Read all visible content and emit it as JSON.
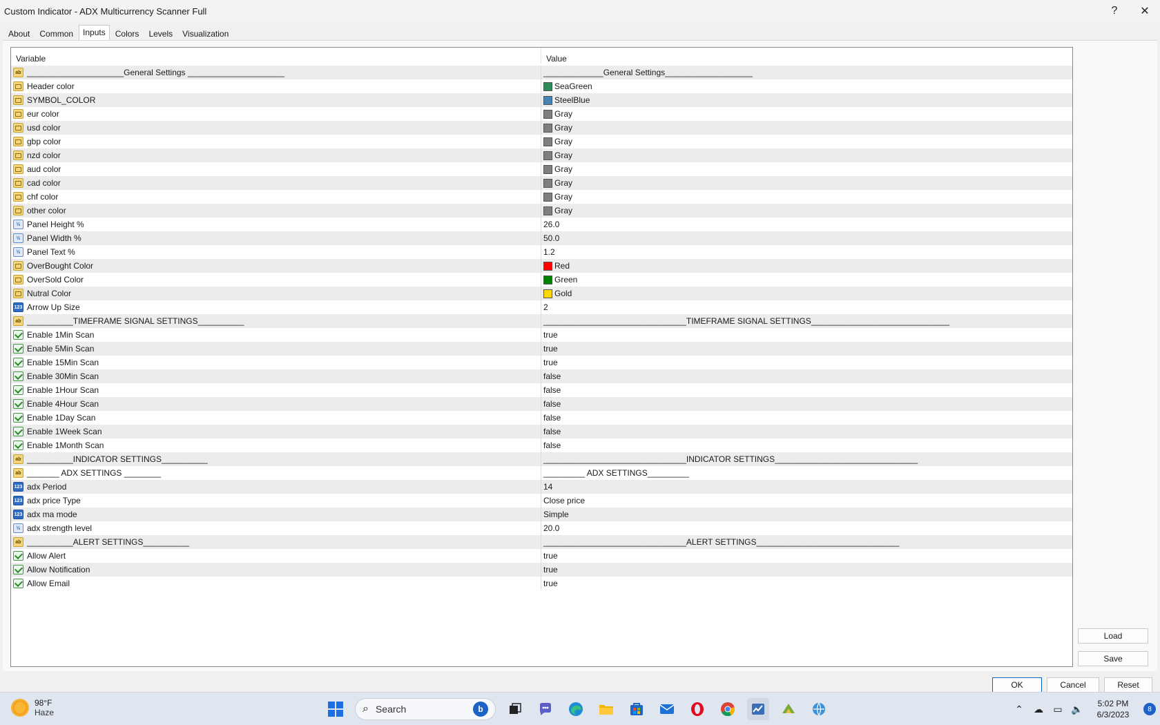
{
  "window": {
    "title": "Custom Indicator - ADX Multicurrency Scanner Full",
    "help_label": "?",
    "close_label": "✕"
  },
  "tabs": [
    {
      "label": "About"
    },
    {
      "label": "Common"
    },
    {
      "label": "Inputs",
      "active": true
    },
    {
      "label": "Colors"
    },
    {
      "label": "Levels"
    },
    {
      "label": "Visualization"
    }
  ],
  "grid": {
    "col_variable": "Variable",
    "col_value": "Value",
    "rows": [
      {
        "type": "ab",
        "variable": "_____________________General Settings _____________________",
        "value": "_____________General Settings___________________"
      },
      {
        "type": "color",
        "variable": "Header color",
        "value": "SeaGreen",
        "swatch": "#2e8b57"
      },
      {
        "type": "color",
        "variable": "SYMBOL_COLOR",
        "value": "SteelBlue",
        "swatch": "#4682b4"
      },
      {
        "type": "color",
        "variable": "eur color",
        "value": "Gray",
        "swatch": "#808080"
      },
      {
        "type": "color",
        "variable": "usd color",
        "value": "Gray",
        "swatch": "#808080"
      },
      {
        "type": "color",
        "variable": "gbp color",
        "value": "Gray",
        "swatch": "#808080"
      },
      {
        "type": "color",
        "variable": "nzd color",
        "value": "Gray",
        "swatch": "#808080"
      },
      {
        "type": "color",
        "variable": "aud color",
        "value": "Gray",
        "swatch": "#808080"
      },
      {
        "type": "color",
        "variable": "cad color",
        "value": "Gray",
        "swatch": "#808080"
      },
      {
        "type": "color",
        "variable": "chf color",
        "value": "Gray",
        "swatch": "#808080"
      },
      {
        "type": "color",
        "variable": "other color",
        "value": "Gray",
        "swatch": "#808080"
      },
      {
        "type": "double",
        "variable": "Panel Height %",
        "value": "26.0"
      },
      {
        "type": "double",
        "variable": "Panel Width %",
        "value": "50.0"
      },
      {
        "type": "double",
        "variable": "Panel Text %",
        "value": "1.2"
      },
      {
        "type": "color",
        "variable": "OverBought Color",
        "value": "Red",
        "swatch": "#ff0000"
      },
      {
        "type": "color",
        "variable": "OverSold Color",
        "value": "Green",
        "swatch": "#008000"
      },
      {
        "type": "color",
        "variable": "Nutral Color",
        "value": "Gold",
        "swatch": "#ffd700"
      },
      {
        "type": "int",
        "variable": "Arrow Up Size",
        "value": "2"
      },
      {
        "type": "ab",
        "variable": "__________TIMEFRAME SIGNAL SETTINGS__________",
        "value": "_______________________________TIMEFRAME SIGNAL SETTINGS______________________________"
      },
      {
        "type": "bool",
        "variable": "Enable 1Min Scan",
        "value": "true"
      },
      {
        "type": "bool",
        "variable": "Enable 5Min Scan",
        "value": "true"
      },
      {
        "type": "bool",
        "variable": "Enable 15Min Scan",
        "value": "true"
      },
      {
        "type": "bool",
        "variable": "Enable 30Min Scan",
        "value": "false"
      },
      {
        "type": "bool",
        "variable": "Enable 1Hour Scan",
        "value": "false"
      },
      {
        "type": "bool",
        "variable": "Enable 4Hour Scan",
        "value": "false"
      },
      {
        "type": "bool",
        "variable": "Enable 1Day Scan",
        "value": "false"
      },
      {
        "type": "bool",
        "variable": "Enable 1Week Scan",
        "value": "false"
      },
      {
        "type": "bool",
        "variable": "Enable 1Month Scan",
        "value": "false"
      },
      {
        "type": "ab",
        "variable": "__________INDICATOR SETTINGS__________",
        "value": "_______________________________INDICATOR SETTINGS_______________________________"
      },
      {
        "type": "ab",
        "variable": "_______ ADX SETTINGS ________",
        "value": "_________ ADX SETTINGS_________"
      },
      {
        "type": "int",
        "variable": "adx Period",
        "value": "14"
      },
      {
        "type": "int",
        "variable": "adx price Type",
        "value": "Close price"
      },
      {
        "type": "int",
        "variable": "adx ma mode",
        "value": "Simple"
      },
      {
        "type": "double",
        "variable": "adx strength level",
        "value": "20.0"
      },
      {
        "type": "ab",
        "variable": "__________ALERT SETTINGS__________",
        "value": "_______________________________ALERT SETTINGS_______________________________"
      },
      {
        "type": "bool",
        "variable": "Allow Alert",
        "value": "true"
      },
      {
        "type": "bool",
        "variable": "Allow Notification",
        "value": "true"
      },
      {
        "type": "bool",
        "variable": "Allow Email",
        "value": "true"
      }
    ]
  },
  "buttons": {
    "load": "Load",
    "save": "Save",
    "ok": "OK",
    "cancel": "Cancel",
    "reset": "Reset"
  },
  "taskbar": {
    "weather_temp": "98°F",
    "weather_desc": "Haze",
    "search_placeholder": "Search",
    "bing_label": "b",
    "time": "5:02 PM",
    "date": "6/3/2023",
    "notification_count": "8",
    "apps": [
      "windows-start",
      "search",
      "task-view",
      "teams-chat",
      "edge",
      "file-explorer",
      "microsoft-store",
      "mail",
      "opera",
      "chrome",
      "metatrader",
      "app-2",
      "app-3"
    ]
  }
}
